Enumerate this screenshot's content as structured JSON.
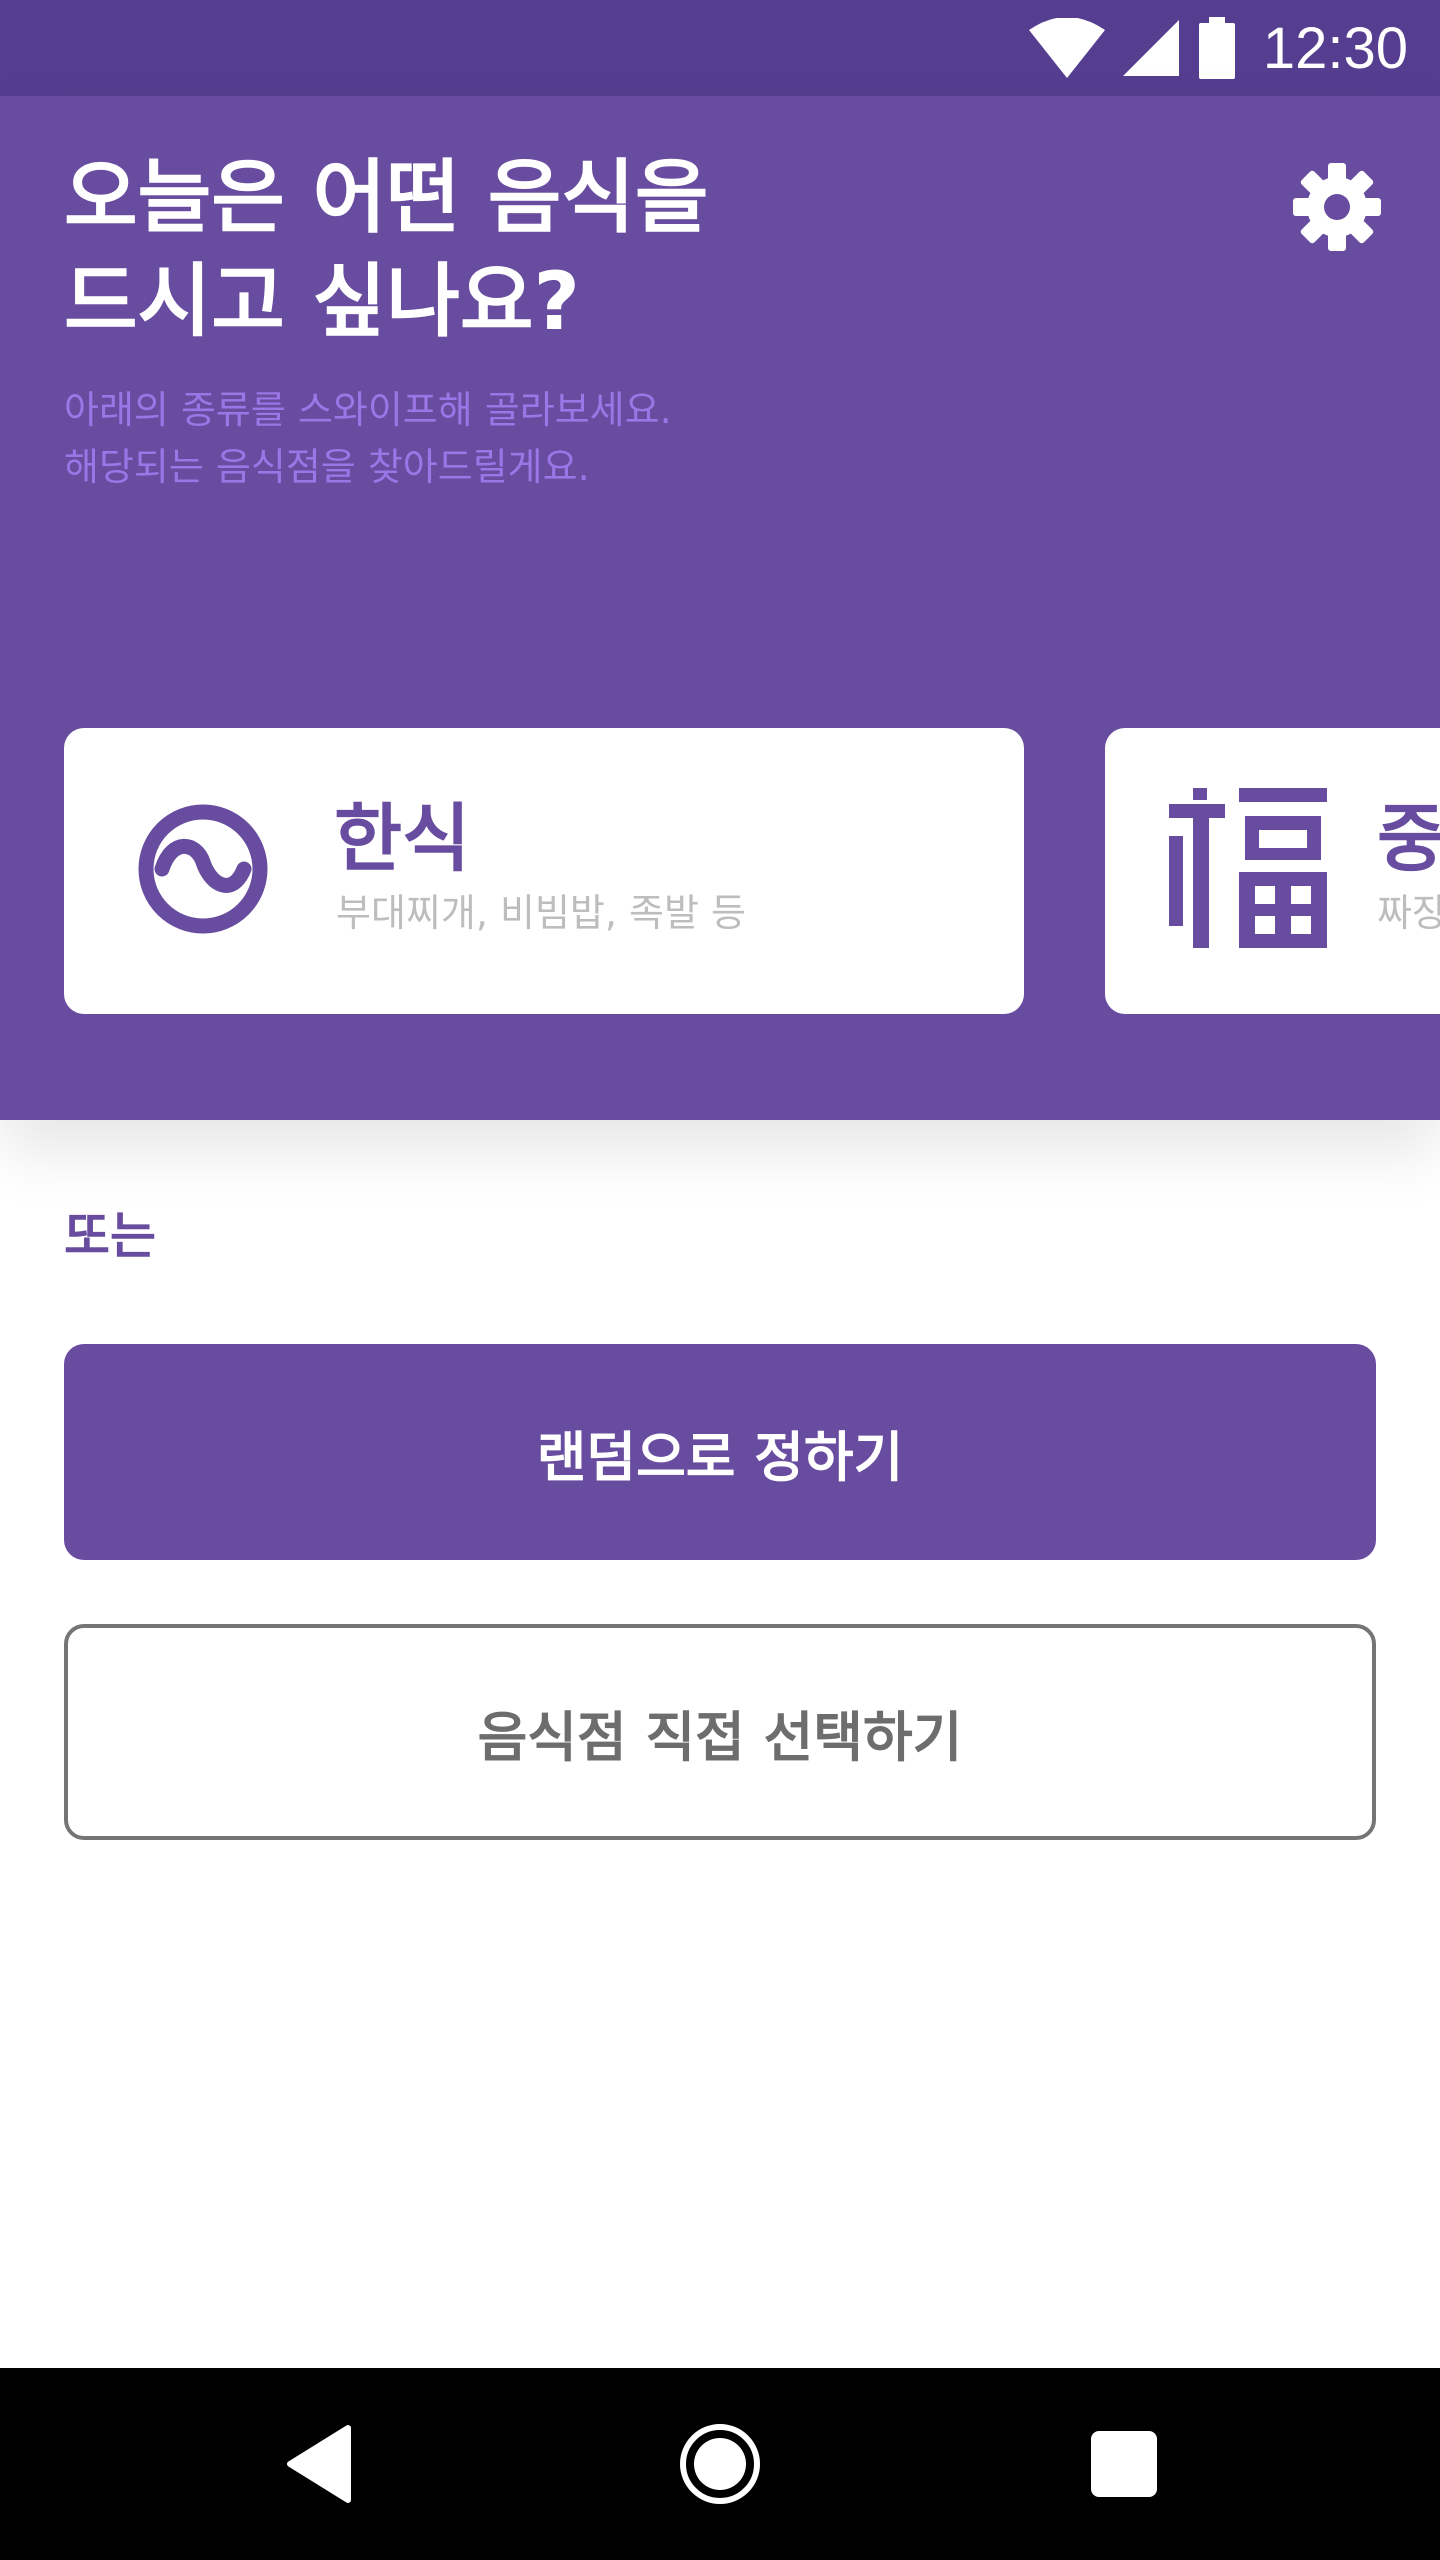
{
  "status_bar": {
    "time": "12:30",
    "icons": [
      "wifi-icon",
      "cellular-signal-icon",
      "battery-icon"
    ]
  },
  "header": {
    "title_lines": [
      "오늘은 어떤 음식을",
      "드시고 싶나요?"
    ],
    "subtitle_lines": [
      "아래의 종류를 스와이프해 골라보세요.",
      "해당되는 음식점을 찾아드릴게요."
    ],
    "settings_icon": "gear-icon"
  },
  "categories": [
    {
      "title": "한식",
      "subtitle": "부대찌개, 비빔밥, 족발 등",
      "icon": "korean-swirl-icon"
    },
    {
      "title": "중",
      "subtitle": "짜장",
      "icon": "fu-character-icon"
    }
  ],
  "alternatives": {
    "or_label": "또는",
    "random_button": "랜덤으로 정하기",
    "direct_button": "음식점 직접 선택하기"
  },
  "nav_bar": {
    "icons": [
      "back-icon",
      "home-icon",
      "recents-icon"
    ]
  },
  "colors": {
    "primary": "#674c9f",
    "status_bar": "#553e90",
    "subtitle": "#9a76e6",
    "card_subtitle": "#bdbdbd",
    "outline": "#757575"
  }
}
